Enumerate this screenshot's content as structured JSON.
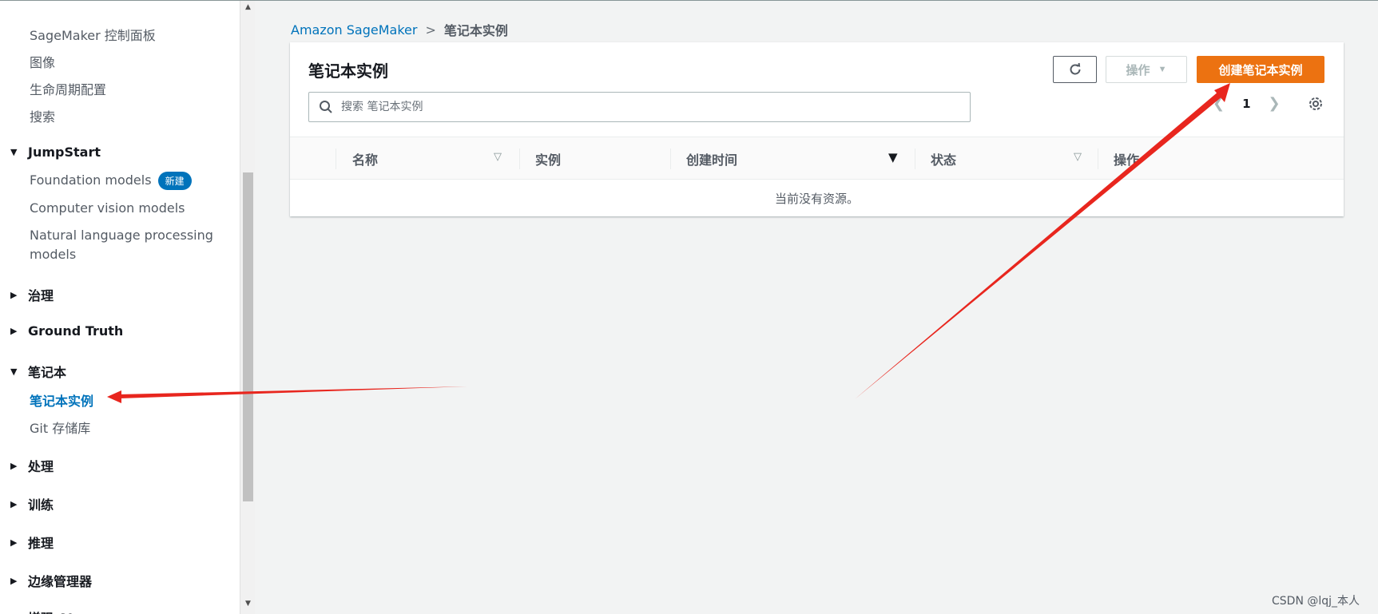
{
  "breadcrumb": {
    "root": "Amazon SageMaker",
    "separator": ">",
    "current": "笔记本实例"
  },
  "sidebar": {
    "items_top": [
      {
        "label": "SageMaker 控制面板"
      },
      {
        "label": "图像"
      },
      {
        "label": "生命周期配置"
      },
      {
        "label": "搜索"
      }
    ],
    "sections": {
      "jumpstart": {
        "label": "JumpStart",
        "expanded": true,
        "items": [
          {
            "label": "Foundation models",
            "badge": "新建"
          },
          {
            "label": "Computer vision models"
          },
          {
            "label": "Natural language processing models"
          }
        ]
      },
      "governance": {
        "label": "治理",
        "expanded": false
      },
      "ground_truth": {
        "label": "Ground Truth",
        "expanded": false
      },
      "notebook": {
        "label": "笔记本",
        "expanded": true,
        "items": [
          {
            "label": "笔记本实例",
            "active": true
          },
          {
            "label": "Git 存储库"
          }
        ]
      },
      "processing": {
        "label": "处理",
        "expanded": false
      },
      "training": {
        "label": "训练",
        "expanded": false
      },
      "inference": {
        "label": "推理",
        "expanded": false
      },
      "edge": {
        "label": "边缘管理器",
        "expanded": false
      },
      "more": {
        "label": "增强 AI",
        "expanded": false
      }
    }
  },
  "panel": {
    "title": "笔记本实例",
    "refresh_icon": "refresh-icon",
    "actions_label": "操作",
    "create_label": "创建笔记本实例",
    "search_placeholder": "搜索 笔记本实例",
    "pagination": {
      "current_page": "1"
    },
    "table": {
      "columns": [
        "名称",
        "实例",
        "创建时间",
        "状态",
        "操作"
      ],
      "sorted_column": "创建时间",
      "empty_text": "当前没有资源。"
    }
  },
  "colors": {
    "primary_button": "#ec7211",
    "link": "#0073bb",
    "annotation_arrow": "#e8261e"
  },
  "watermark": "CSDN @lqj_本人"
}
